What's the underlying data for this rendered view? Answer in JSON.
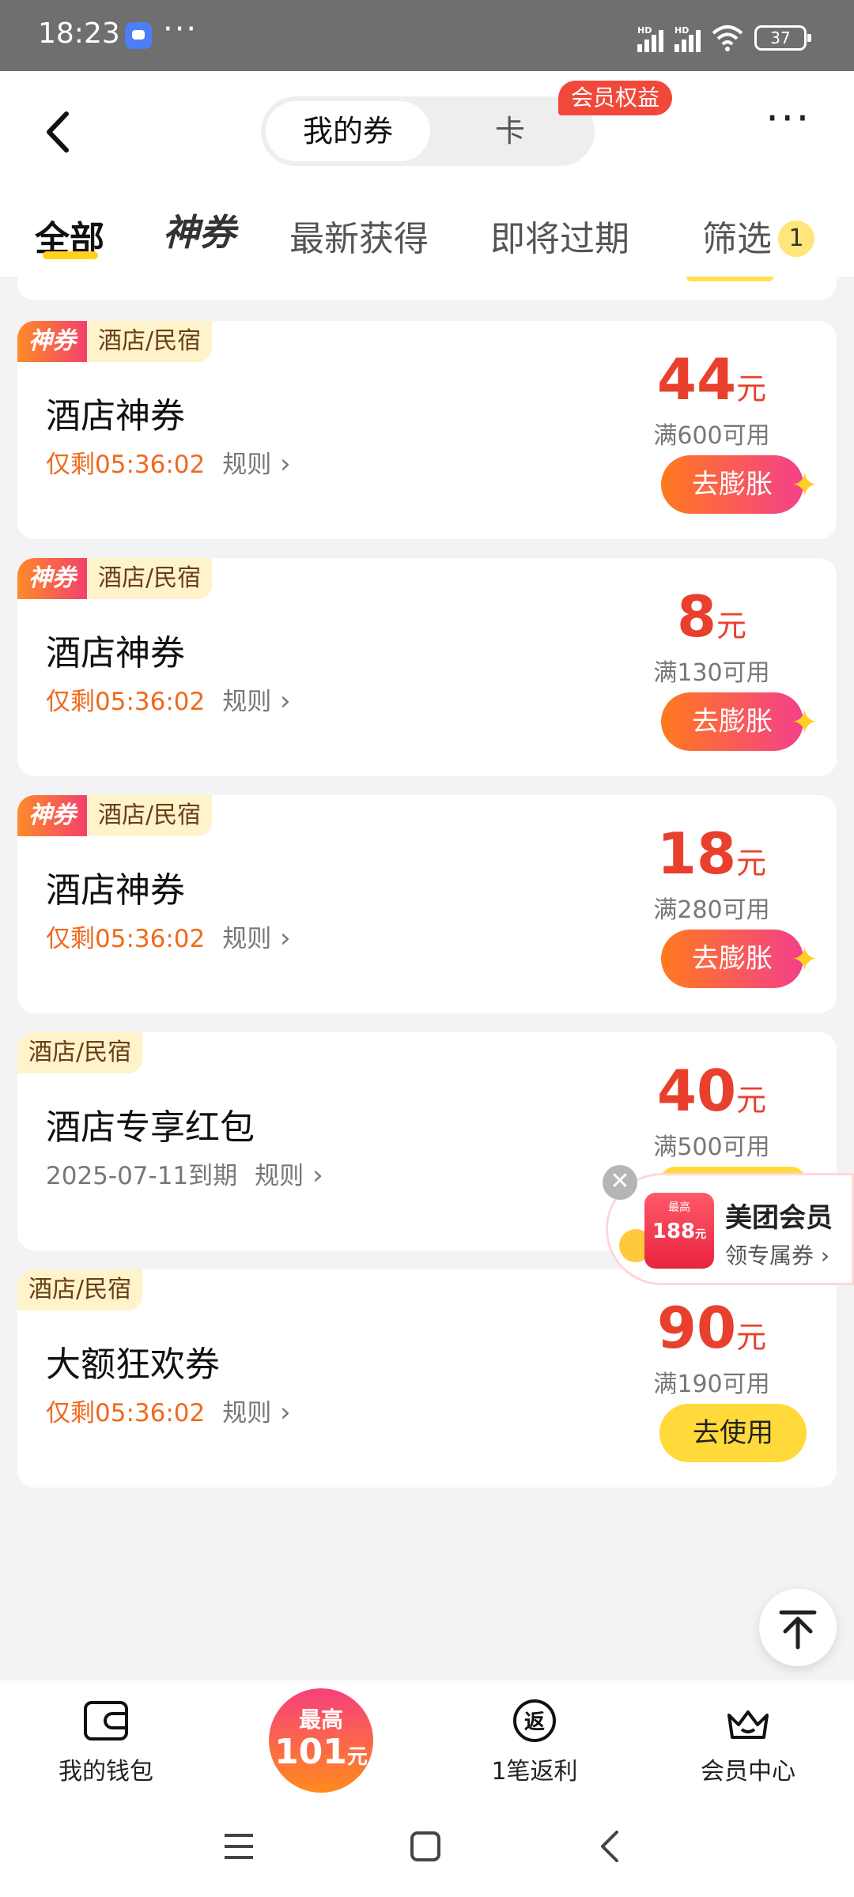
{
  "status_bar": {
    "time": "18:23",
    "dots": "···",
    "hd1": "HD",
    "hd2": "HD",
    "battery": "37"
  },
  "header": {
    "segment_active": "我的券",
    "segment_inactive": "卡",
    "member_badge": "会员权益",
    "more": "···"
  },
  "tabs": {
    "all": "全部",
    "shen": "神券",
    "latest": "最新获得",
    "expiring": "即将过期",
    "filter": "筛选",
    "filter_count": "1"
  },
  "coupons": [
    {
      "tag_shen": "神券",
      "tag_cat": "酒店/民宿",
      "title": "酒店神券",
      "countdown": "仅剩05:36:02",
      "rule": "规则",
      "amount": "44",
      "unit": "元",
      "condition": "满600可用",
      "button": "去膨胀"
    },
    {
      "tag_shen": "神券",
      "tag_cat": "酒店/民宿",
      "title": "酒店神券",
      "countdown": "仅剩05:36:02",
      "rule": "规则",
      "amount": "8",
      "unit": "元",
      "condition": "满130可用",
      "button": "去膨胀"
    },
    {
      "tag_shen": "神券",
      "tag_cat": "酒店/民宿",
      "title": "酒店神券",
      "countdown": "仅剩05:36:02",
      "rule": "规则",
      "amount": "18",
      "unit": "元",
      "condition": "满280可用",
      "button": "去膨胀"
    },
    {
      "tag_cat": "酒店/民宿",
      "title": "酒店专享红包",
      "expiry": "2025-07-11到期",
      "rule": "规则",
      "amount": "40",
      "unit": "元",
      "condition": "满500可用"
    },
    {
      "tag_cat": "酒店/民宿",
      "title": "大额狂欢券",
      "countdown": "仅剩05:36:02",
      "rule": "规则",
      "amount": "90",
      "unit": "元",
      "condition": "满190可用",
      "button": "去使用"
    }
  ],
  "float_promo": {
    "close": "✕",
    "art_top": "最高",
    "art_num": "188",
    "art_unit": "元",
    "title": "美团会员",
    "subtitle": "领专属券 ›"
  },
  "bottom_nav": {
    "wallet": "我的钱包",
    "promo_top": "最高",
    "promo_amount": "101",
    "promo_unit": "元",
    "rebate": "1笔返利",
    "member": "会员中心"
  },
  "colors": {
    "accent_yellow": "#ffda3a",
    "price_red": "#e8402c",
    "countdown_orange": "#f06a1d"
  }
}
